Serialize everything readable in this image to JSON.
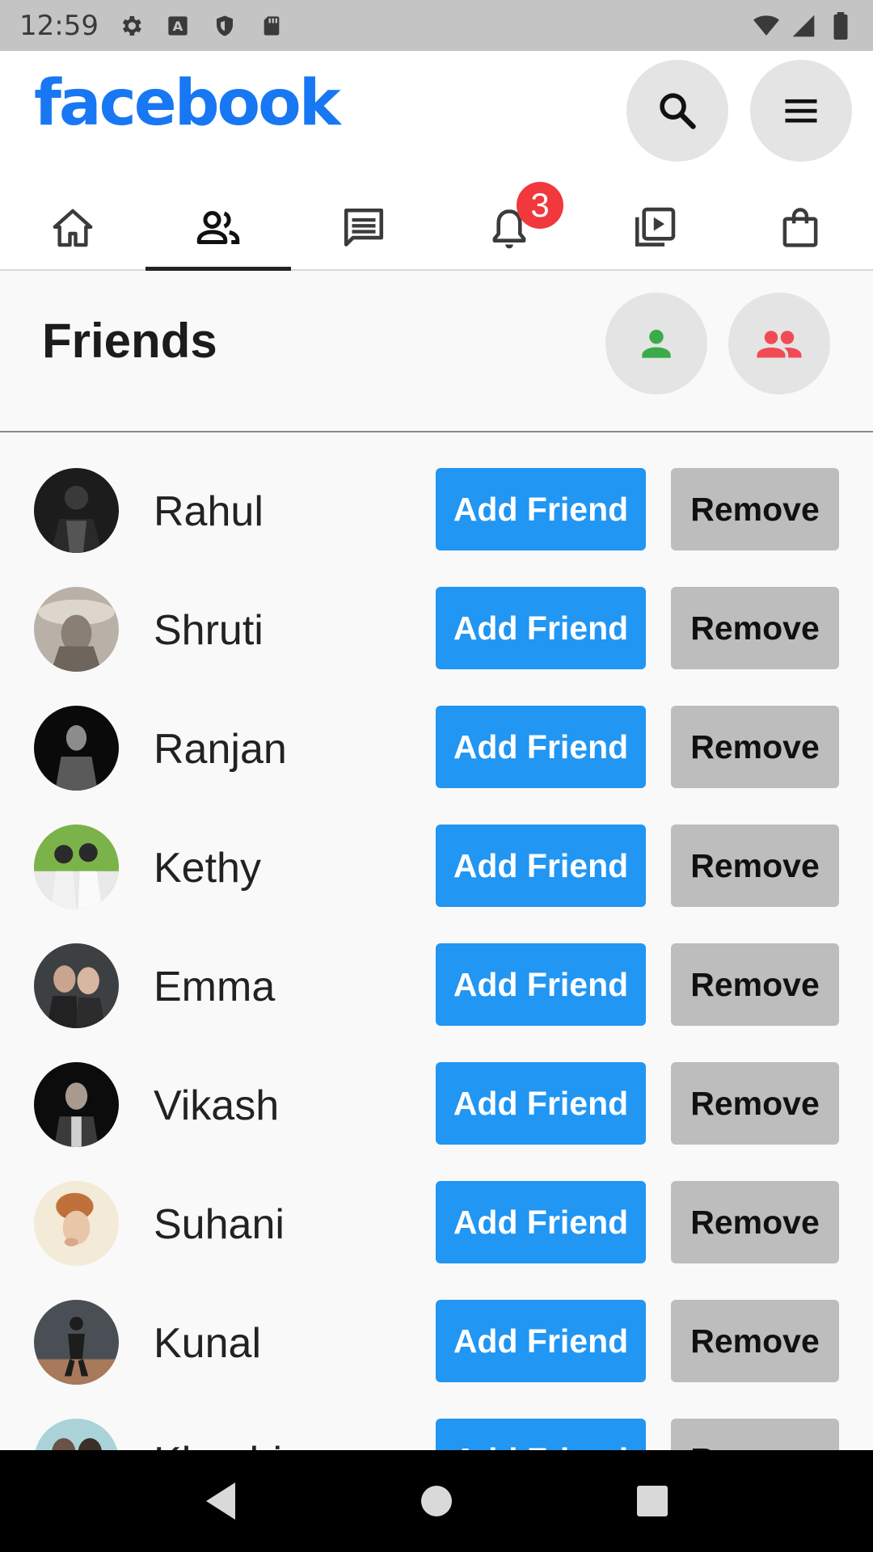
{
  "status_bar": {
    "time": "12:59",
    "left_icons": [
      "settings-icon",
      "a-icon",
      "shield-icon",
      "sd-card-icon"
    ],
    "right_icons": [
      "wifi-icon",
      "signal-icon",
      "battery-icon"
    ]
  },
  "header": {
    "logo": "facebook",
    "brand_color": "#1877f2",
    "actions": [
      "search-icon",
      "menu-icon"
    ]
  },
  "tabs": [
    {
      "icon": "home-icon",
      "active": false
    },
    {
      "icon": "friends-icon",
      "active": true
    },
    {
      "icon": "messages-icon",
      "active": false
    },
    {
      "icon": "bell-icon",
      "active": false,
      "badge": "3"
    },
    {
      "icon": "video-icon",
      "active": false
    },
    {
      "icon": "marketplace-icon",
      "active": false
    }
  ],
  "friends_section": {
    "title": "Friends",
    "person_icon_color": "#3bab4a",
    "people_icon_color": "#f04b55"
  },
  "buttons": {
    "add_label": "Add Friend",
    "remove_label": "Remove",
    "add_color": "#2196f3",
    "remove_color": "#bdbdbd"
  },
  "friends": [
    {
      "name": "Rahul",
      "add": "Add Friend",
      "remove": "Remove"
    },
    {
      "name": "Shruti",
      "add": "Add Friend",
      "remove": "Remove"
    },
    {
      "name": "Ranjan",
      "add": "Add Friend",
      "remove": "Remove"
    },
    {
      "name": "Kethy",
      "add": "Add Friend",
      "remove": "Remove"
    },
    {
      "name": "Emma",
      "add": "Add Friend",
      "remove": "Remove"
    },
    {
      "name": "Vikash",
      "add": "Add Friend",
      "remove": "Remove"
    },
    {
      "name": "Suhani",
      "add": "Add Friend",
      "remove": "Remove"
    },
    {
      "name": "Kunal",
      "add": "Add Friend",
      "remove": "Remove"
    },
    {
      "name": "Khushi",
      "add": "Add Friend",
      "remove": "Remove"
    }
  ]
}
